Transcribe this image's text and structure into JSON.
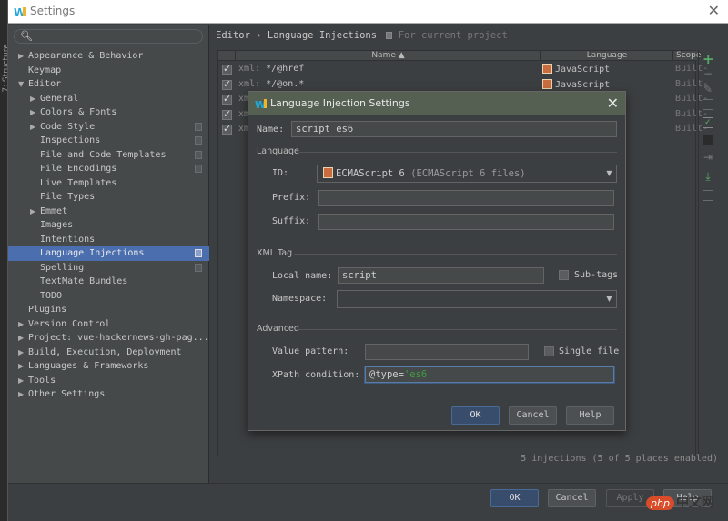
{
  "window": {
    "title": "Settings",
    "close_icon": "close-icon"
  },
  "ide_strip": {
    "label": "7: Structure"
  },
  "sidebar": {
    "search": {
      "placeholder": "",
      "value": ""
    },
    "items": [
      {
        "label": "Appearance & Behavior",
        "level": 0,
        "expandable": true,
        "expanded": false,
        "badge": false
      },
      {
        "label": "Keymap",
        "level": 0,
        "expandable": false,
        "badge": false
      },
      {
        "label": "Editor",
        "level": 0,
        "expandable": true,
        "expanded": true,
        "badge": false
      },
      {
        "label": "General",
        "level": 1,
        "expandable": true,
        "expanded": false,
        "badge": false
      },
      {
        "label": "Colors & Fonts",
        "level": 1,
        "expandable": true,
        "expanded": false,
        "badge": false
      },
      {
        "label": "Code Style",
        "level": 1,
        "expandable": true,
        "expanded": false,
        "badge": true
      },
      {
        "label": "Inspections",
        "level": 1,
        "expandable": false,
        "badge": true
      },
      {
        "label": "File and Code Templates",
        "level": 1,
        "expandable": false,
        "badge": true
      },
      {
        "label": "File Encodings",
        "level": 1,
        "expandable": false,
        "badge": true
      },
      {
        "label": "Live Templates",
        "level": 1,
        "expandable": false,
        "badge": false
      },
      {
        "label": "File Types",
        "level": 1,
        "expandable": false,
        "badge": false
      },
      {
        "label": "Emmet",
        "level": 1,
        "expandable": true,
        "expanded": false,
        "badge": false
      },
      {
        "label": "Images",
        "level": 1,
        "expandable": false,
        "badge": false
      },
      {
        "label": "Intentions",
        "level": 1,
        "expandable": false,
        "badge": false
      },
      {
        "label": "Language Injections",
        "level": 1,
        "expandable": false,
        "badge": true,
        "selected": true
      },
      {
        "label": "Spelling",
        "level": 1,
        "expandable": false,
        "badge": true
      },
      {
        "label": "TextMate Bundles",
        "level": 1,
        "expandable": false,
        "badge": false
      },
      {
        "label": "TODO",
        "level": 1,
        "expandable": false,
        "badge": false
      },
      {
        "label": "Plugins",
        "level": 0,
        "expandable": false,
        "badge": false
      },
      {
        "label": "Version Control",
        "level": 0,
        "expandable": true,
        "expanded": false,
        "badge": false
      },
      {
        "label": "Project: vue-hackernews-gh-pag...",
        "level": 0,
        "expandable": true,
        "expanded": false,
        "badge": false
      },
      {
        "label": "Build, Execution, Deployment",
        "level": 0,
        "expandable": true,
        "expanded": false,
        "badge": false
      },
      {
        "label": "Languages & Frameworks",
        "level": 0,
        "expandable": true,
        "expanded": false,
        "badge": false
      },
      {
        "label": "Tools",
        "level": 0,
        "expandable": true,
        "expanded": false,
        "badge": false
      },
      {
        "label": "Other Settings",
        "level": 0,
        "expandable": true,
        "expanded": false,
        "badge": false
      }
    ]
  },
  "content": {
    "breadcrumb": {
      "parent": "Editor",
      "separator": "›",
      "current": "Language Injections",
      "scope_note": "For current project"
    },
    "table": {
      "columns": [
        "",
        "Name ▲",
        "Language",
        "Scope"
      ],
      "rows": [
        {
          "checked": true,
          "prefix": "xml:",
          "name": "*/@href",
          "language": "JavaScript",
          "scope": "Built-"
        },
        {
          "checked": true,
          "prefix": "xml:",
          "name": "*/@on.*",
          "language": "JavaScript",
          "scope": "Built-"
        },
        {
          "checked": true,
          "prefix": "xm",
          "name": "",
          "language": "",
          "scope": "Built-"
        },
        {
          "checked": true,
          "prefix": "xm",
          "name": "",
          "language": "",
          "scope": "Built-"
        },
        {
          "checked": true,
          "prefix": "xm",
          "name": "",
          "language": "",
          "scope": "Built-"
        }
      ]
    },
    "toolbar": [
      "add-icon",
      "remove-icon",
      "edit-icon",
      "copy-icon",
      "enable-icon",
      "disable-icon",
      "import-icon",
      "export-icon",
      "advanced-icon"
    ],
    "status": "5 injections (5 of 5 places enabled)"
  },
  "footer": {
    "ok": "OK",
    "cancel": "Cancel",
    "apply": "Apply",
    "help": "Help"
  },
  "watermark": {
    "php": "php",
    "cn": "中文网"
  },
  "dialog": {
    "title": "Language Injection Settings",
    "name_label": "Name:",
    "name_value": "script es6",
    "language_section": "Language",
    "id_label": "ID:",
    "id_value": "ECMAScript 6",
    "id_desc": "(ECMAScript 6 files)",
    "prefix_label": "Prefix:",
    "prefix_value": "",
    "suffix_label": "Suffix:",
    "suffix_value": "",
    "xml_section": "XML Tag",
    "local_name_label": "Local name:",
    "local_name_value": "script",
    "subtags_label": "Sub-tags",
    "subtags_checked": false,
    "namespace_label": "Namespace:",
    "namespace_value": "",
    "advanced_section": "Advanced",
    "value_pattern_label": "Value pattern:",
    "value_pattern_value": "",
    "single_file_label": "Single file",
    "single_file_checked": false,
    "xpath_label": "XPath condition:",
    "xpath_value_prefix": "@type=",
    "xpath_value_string": "'es6'",
    "ok": "OK",
    "cancel": "Cancel",
    "help": "Help"
  }
}
